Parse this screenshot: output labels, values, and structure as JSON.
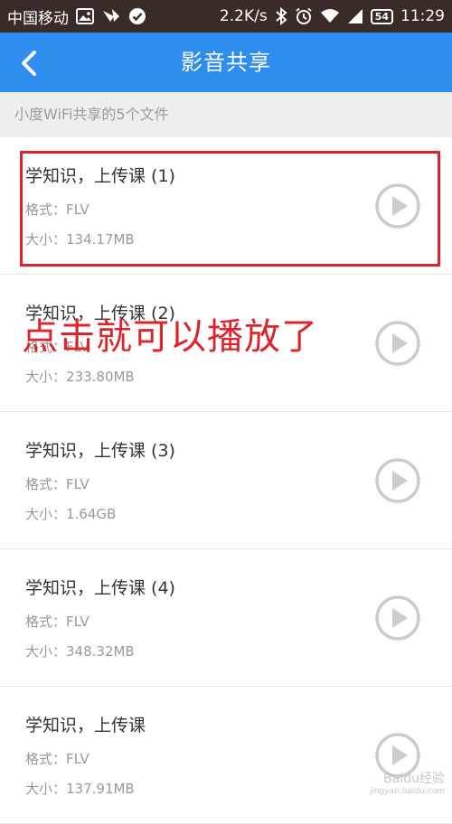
{
  "status_bar": {
    "carrier": "中国移动",
    "speed": "2.2K/s",
    "battery": "54",
    "time": "11:29",
    "icons": [
      "image-icon",
      "network-icon",
      "check-icon",
      "bluetooth-icon",
      "alarm-icon",
      "wifi-icon",
      "signal-icon",
      "battery-icon"
    ]
  },
  "app_bar": {
    "title": "影音共享",
    "back_icon": "chevron-left-icon",
    "color": "#2d8ef0"
  },
  "subheader": "小度WiFi共享的5个文件",
  "files": [
    {
      "title": "学知识，上传课 (1)",
      "format": "格式：FLV",
      "size": "大小：134.17MB"
    },
    {
      "title": "学知识，上传课 (2)",
      "format": "格式：FLV",
      "size": "大小：233.80MB"
    },
    {
      "title": "学知识，上传课 (3)",
      "format": "格式：FLV",
      "size": "大小：1.64GB"
    },
    {
      "title": "学知识，上传课 (4)",
      "format": "格式：FLV",
      "size": "大小：348.32MB"
    },
    {
      "title": "学知识，上传课",
      "format": "格式：FLV",
      "size": "大小：137.91MB"
    }
  ],
  "annotation": {
    "text": "点击就可以播放了",
    "color": "#e0232b"
  },
  "watermark": {
    "text": "Baidu经验",
    "sub": "jingyan.baidu.com"
  }
}
